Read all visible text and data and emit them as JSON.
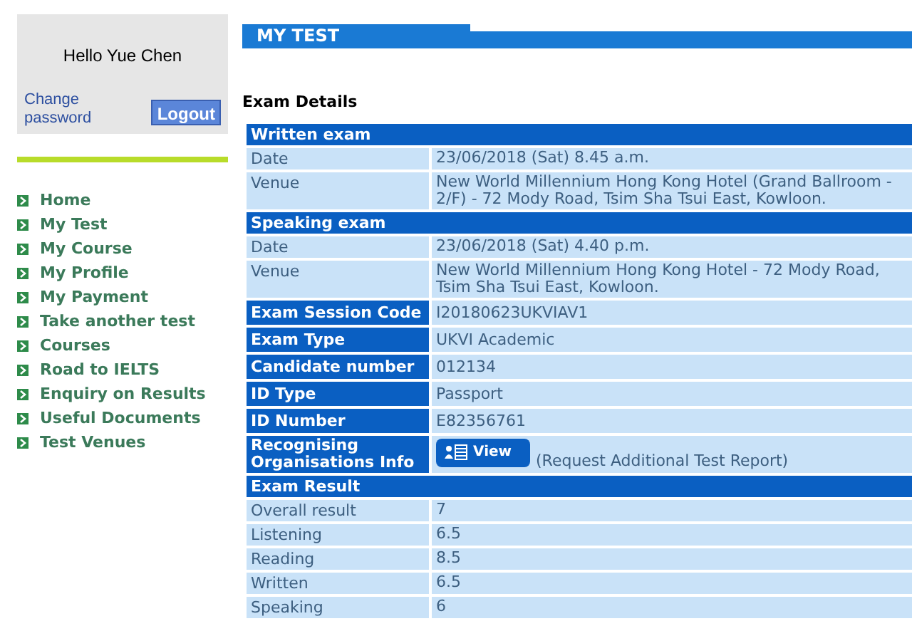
{
  "user_box": {
    "greeting": "Hello Yue Chen",
    "change_password": "Change password",
    "logout": "Logout"
  },
  "nav": [
    {
      "label": "Home"
    },
    {
      "label": "My Test"
    },
    {
      "label": "My Course"
    },
    {
      "label": "My Profile"
    },
    {
      "label": "My Payment"
    },
    {
      "label": "Take another test"
    },
    {
      "label": "Courses"
    },
    {
      "label": "Road to IELTS"
    },
    {
      "label": "Enquiry on Results"
    },
    {
      "label": "Useful Documents"
    },
    {
      "label": "Test Venues"
    }
  ],
  "page_title": "MY TEST",
  "section_title": "Exam Details",
  "rows": [
    {
      "kind": "section",
      "label": "Written exam"
    },
    {
      "kind": "plain",
      "label": "Date",
      "value": "23/06/2018 (Sat) 8.45 a.m."
    },
    {
      "kind": "plain",
      "label": "Venue",
      "value": "New World Millennium Hong Kong Hotel (Grand Ballroom - 2/F) - 72 Mody Road, Tsim Sha Tsui East, Kowloon."
    },
    {
      "kind": "section",
      "label": "Speaking exam"
    },
    {
      "kind": "plain",
      "label": "Date",
      "value": "23/06/2018 (Sat) 4.40 p.m."
    },
    {
      "kind": "plain",
      "label": "Venue",
      "value": "New World Millennium Hong Kong Hotel - 72 Mody Road, Tsim Sha Tsui East, Kowloon."
    },
    {
      "kind": "key",
      "label": "Exam Session Code",
      "value": "I20180623UKVIAV1"
    },
    {
      "kind": "key",
      "label": "Exam Type",
      "value": "UKVI Academic"
    },
    {
      "kind": "key",
      "label": "Candidate number",
      "value": "012134"
    },
    {
      "kind": "key",
      "label": "ID Type",
      "value": "Passport"
    },
    {
      "kind": "key",
      "label": "ID Number",
      "value": "E82356761"
    },
    {
      "kind": "action",
      "label": "Recognising Organisations Info",
      "button": "View",
      "note": "(Request Additional Test Report)"
    },
    {
      "kind": "section",
      "label": "Exam Result"
    },
    {
      "kind": "plain",
      "label": "Overall result",
      "value": "7"
    },
    {
      "kind": "plain",
      "label": "Listening",
      "value": "6.5"
    },
    {
      "kind": "plain",
      "label": "Reading",
      "value": "8.5"
    },
    {
      "kind": "plain",
      "label": "Written",
      "value": "6.5"
    },
    {
      "kind": "plain",
      "label": "Speaking",
      "value": "6"
    }
  ]
}
